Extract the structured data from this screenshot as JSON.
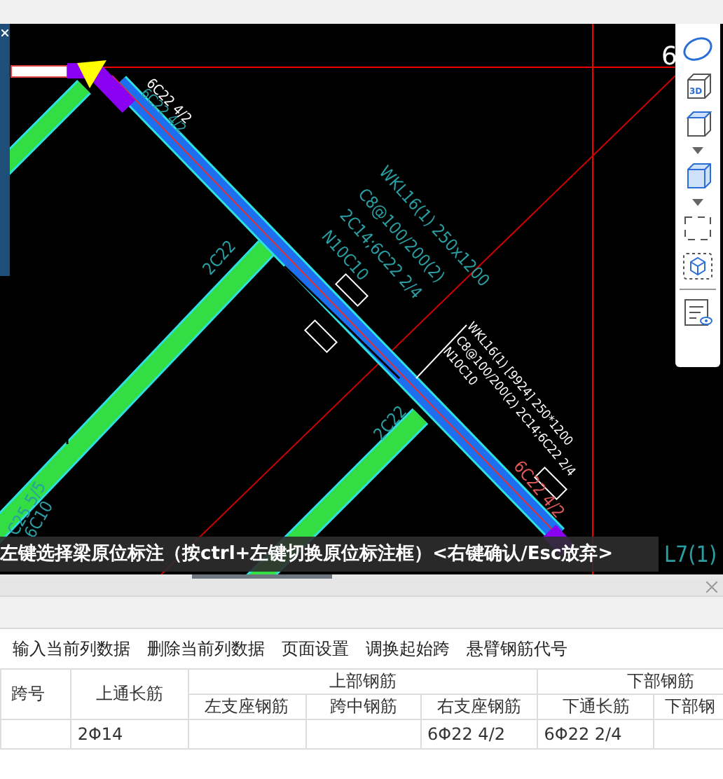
{
  "canvas": {
    "scale_mark": "6",
    "labels": [
      {
        "text": "6C22 4/2",
        "kind": "white"
      },
      {
        "text": "6C22 4/2",
        "kind": "teal"
      },
      {
        "text": "WKL16(1) 250x1200",
        "kind": "teal"
      },
      {
        "text": "C8@100/200(2)",
        "kind": "teal"
      },
      {
        "text": "2C14;6C22 2/4",
        "kind": "teal"
      },
      {
        "text": "N10C10",
        "kind": "teal"
      },
      {
        "text": "2C22",
        "kind": "teal"
      },
      {
        "text": "2C22",
        "kind": "teal"
      },
      {
        "text": "WKL16(1) [9924] 250*1200",
        "kind": "white"
      },
      {
        "text": "C8@100/200(2) 2C14;6C22 2/4",
        "kind": "white"
      },
      {
        "text": "N10C10",
        "kind": "white"
      },
      {
        "text": "6C22 4/2",
        "kind": "red"
      },
      {
        "text": "C25 5/5",
        "kind": "teal"
      },
      {
        "text": "6C10",
        "kind": "teal"
      },
      {
        "text": "L7(1)",
        "kind": "teal"
      }
    ],
    "view_badge": "3D",
    "status": "左键选择梁原位标注（按ctrl+左键切换原位标注框）<右键确认/Esc放弃>"
  },
  "panel": {
    "toolbar": [
      "输入当前列数据",
      "删除当前列数据",
      "页面设置",
      "调换起始跨",
      "悬臂钢筋代号"
    ],
    "table": {
      "columns": [
        {
          "label": "跨号"
        },
        {
          "label": "上通长筋",
          "cells": [
            "2Φ14"
          ]
        },
        {
          "group": "上部钢筋",
          "children": [
            {
              "label": "左支座钢筋"
            },
            {
              "label": "跨中钢筋"
            },
            {
              "label": "右支座钢筋",
              "cells": [
                "6Φ22 4/2"
              ]
            }
          ]
        },
        {
          "group": "下部钢筋",
          "children": [
            {
              "label": "下通长筋",
              "cells": [
                "6Φ22 2/4"
              ]
            },
            {
              "label": "下部钢"
            }
          ]
        }
      ]
    }
  }
}
